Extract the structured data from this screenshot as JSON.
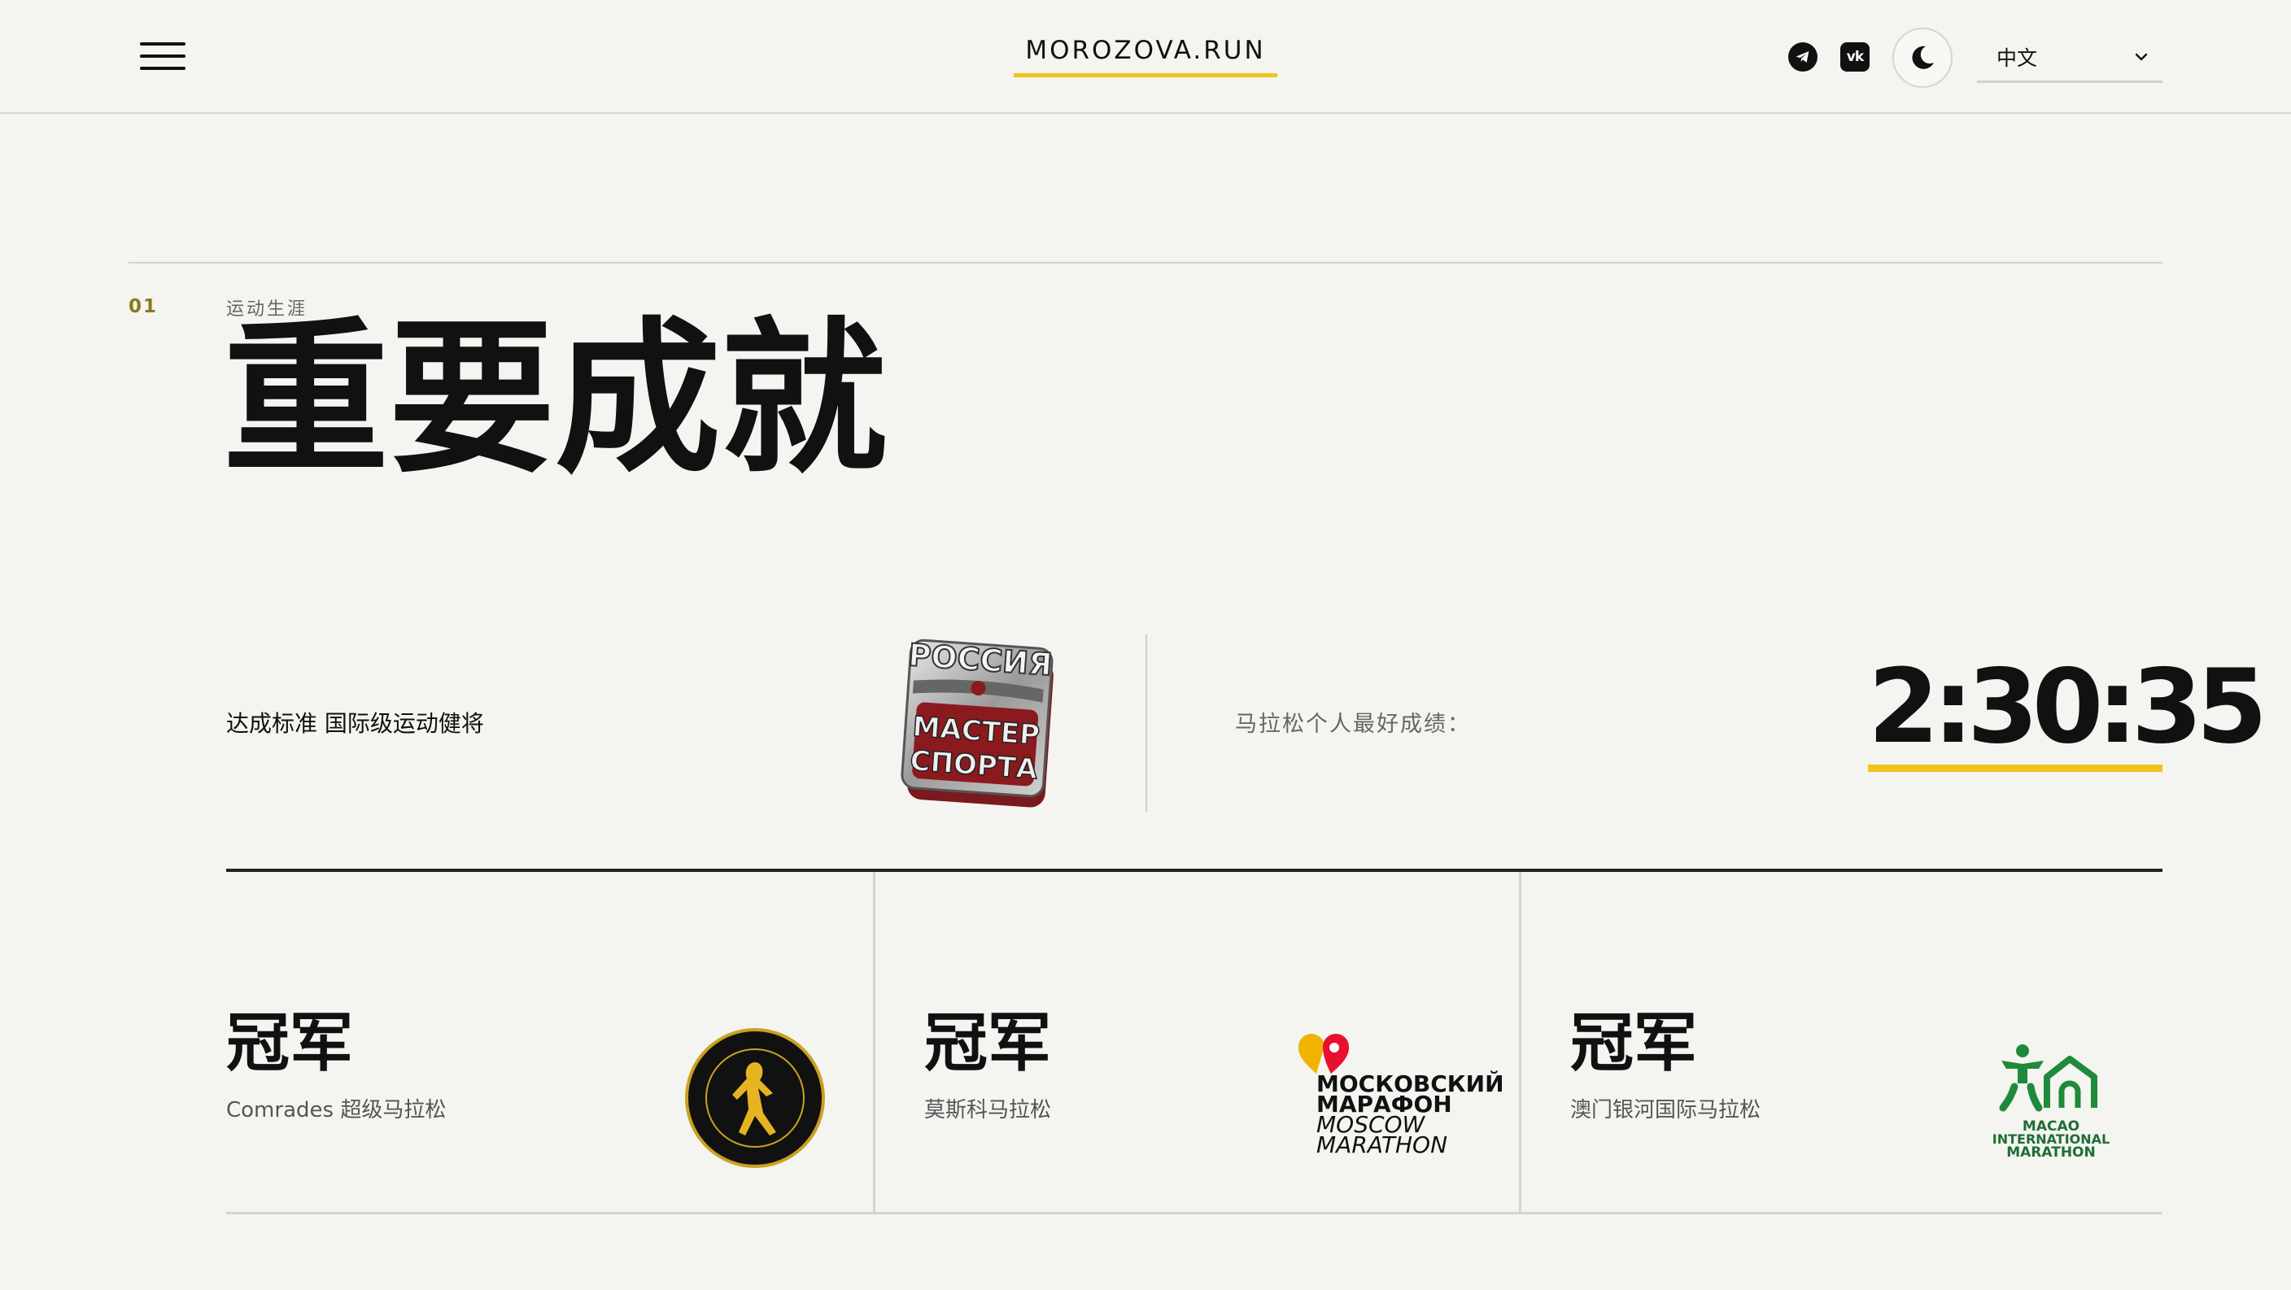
{
  "header": {
    "logo": "MOROZOVA.RUN",
    "language": "中文",
    "icons": [
      "menu-icon",
      "telegram-icon",
      "vk-icon",
      "moon-icon",
      "chevron-down-icon"
    ],
    "accent_color": "#f0c419"
  },
  "section": {
    "number": "01",
    "eyebrow": "运动生涯",
    "title": "重要成就"
  },
  "standard": {
    "text": "达成标准 国际级运动健将",
    "badge": {
      "line1": "РОССИЯ",
      "line2": "МАСТЕР",
      "line3": "СПОРТА"
    }
  },
  "personal_best": {
    "label": "马拉松个人最好成绩：",
    "time": "2:30:35"
  },
  "cards": [
    {
      "title": "冠军",
      "subtitle": "Comrades 超级马拉松",
      "logo": "comrades-logo"
    },
    {
      "title": "冠军",
      "subtitle": "莫斯科马拉松",
      "logo": "moscow-marathon-logo",
      "logo_text": {
        "ru1": "МОСКОВСКИЙ",
        "ru2": "МАРАФОН",
        "en1": "MOSCOW",
        "en2": "MARATHON"
      }
    },
    {
      "title": "冠军",
      "subtitle": "澳门银河国际马拉松",
      "logo": "macao-marathon-logo",
      "logo_text": {
        "l1": "MACAO",
        "l2": "INTERNATIONAL",
        "l3": "MARATHON"
      }
    }
  ]
}
